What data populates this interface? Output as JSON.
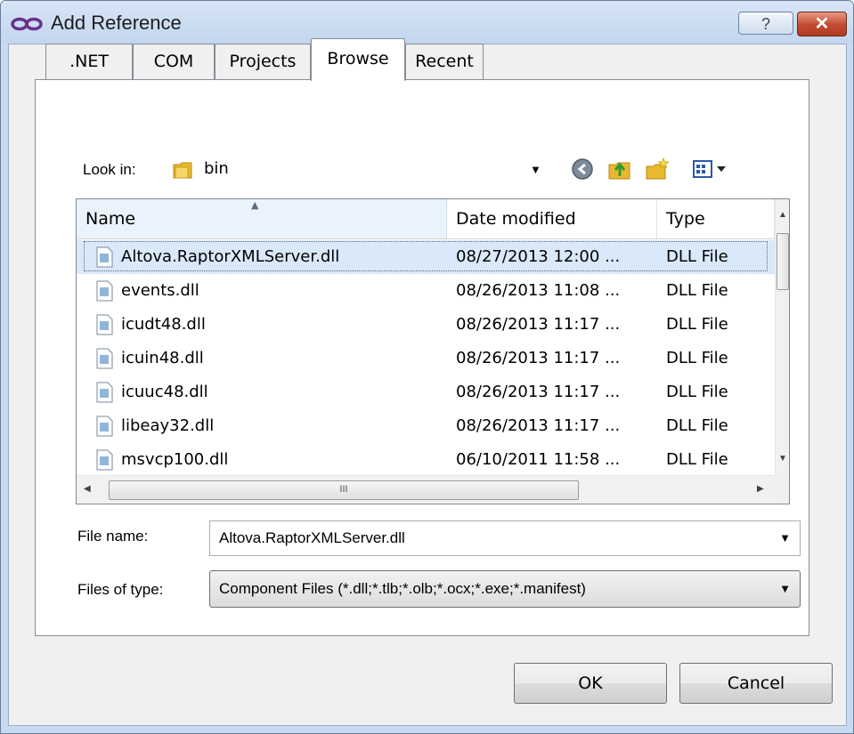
{
  "window": {
    "title": "Add Reference",
    "help_label": "?",
    "close_label": "✕"
  },
  "tabs": [
    {
      "label": ".NET",
      "active": false
    },
    {
      "label": "COM",
      "active": false
    },
    {
      "label": "Projects",
      "active": false
    },
    {
      "label": "Browse",
      "active": true
    },
    {
      "label": "Recent",
      "active": false
    }
  ],
  "look_in": {
    "label": "Look in:",
    "value": "bin",
    "icon": "folder-icon"
  },
  "toolbar": {
    "icons": [
      "back-icon",
      "up-folder-icon",
      "new-folder-icon",
      "view-menu-icon"
    ]
  },
  "file_list": {
    "columns": [
      "Name",
      "Date modified",
      "Type"
    ],
    "sorted_column": "Name",
    "rows": [
      {
        "name": "Altova.RaptorXMLServer.dll",
        "date": "08/27/2013 12:00 ...",
        "type": "DLL File",
        "selected": true
      },
      {
        "name": "events.dll",
        "date": "08/26/2013 11:08 ...",
        "type": "DLL File",
        "selected": false
      },
      {
        "name": "icudt48.dll",
        "date": "08/26/2013 11:17 ...",
        "type": "DLL File",
        "selected": false
      },
      {
        "name": "icuin48.dll",
        "date": "08/26/2013 11:17 ...",
        "type": "DLL File",
        "selected": false
      },
      {
        "name": "icuuc48.dll",
        "date": "08/26/2013 11:17 ...",
        "type": "DLL File",
        "selected": false
      },
      {
        "name": "libeay32.dll",
        "date": "08/26/2013 11:17 ...",
        "type": "DLL File",
        "selected": false
      },
      {
        "name": "msvcp100.dll",
        "date": "06/10/2011 11:58 ...",
        "type": "DLL File",
        "selected": false
      }
    ],
    "hscroll_grip": "III"
  },
  "file_name": {
    "label": "File name:",
    "value": "Altova.RaptorXMLServer.dll"
  },
  "file_type": {
    "label": "Files of type:",
    "value": "Component Files (*.dll;*.tlb;*.olb;*.ocx;*.exe;*.manifest)"
  },
  "buttons": {
    "ok": "OK",
    "cancel": "Cancel"
  },
  "colors": {
    "titlebar": "#c3d6ee",
    "selection": "#d9e9fa",
    "close_button": "#c14a30"
  }
}
